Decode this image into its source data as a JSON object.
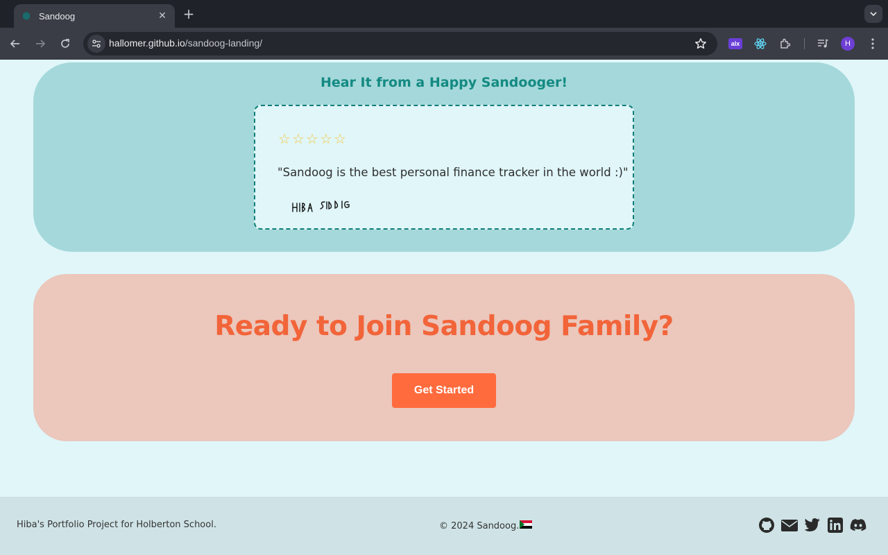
{
  "browser": {
    "tab_title": "Sandoog",
    "url_host": "hallomer.github.io",
    "url_path": "/sandoog-landing/",
    "avatar_letter": "H",
    "extension_alx_label": "alx"
  },
  "testimonial": {
    "heading": "Hear It from a Happy Sandooger!",
    "stars": [
      "☆",
      "☆",
      "☆",
      "☆",
      "☆"
    ],
    "rating": 5,
    "quote": "\"Sandoog is the best personal finance tracker in the world :)\"",
    "signature": "HIBA SIDDIG"
  },
  "cta": {
    "heading": "Ready to Join Sandoog Family?",
    "button_label": "Get Started"
  },
  "footer": {
    "left_text": "Hiba's Portfolio Project for Holberton School.",
    "copyright": "© 2024 Sandoog.",
    "social_icons": [
      "github-icon",
      "email-icon",
      "twitter-icon",
      "linkedin-icon",
      "discord-icon"
    ]
  },
  "colors": {
    "page_bg": "#e0f6f9",
    "testimonial_bg": "#a5d8da",
    "accent_teal": "#138a82",
    "cta_bg": "#ebc7bc",
    "cta_accent": "#ff6b3d",
    "footer_bg": "#cfe3e6"
  }
}
